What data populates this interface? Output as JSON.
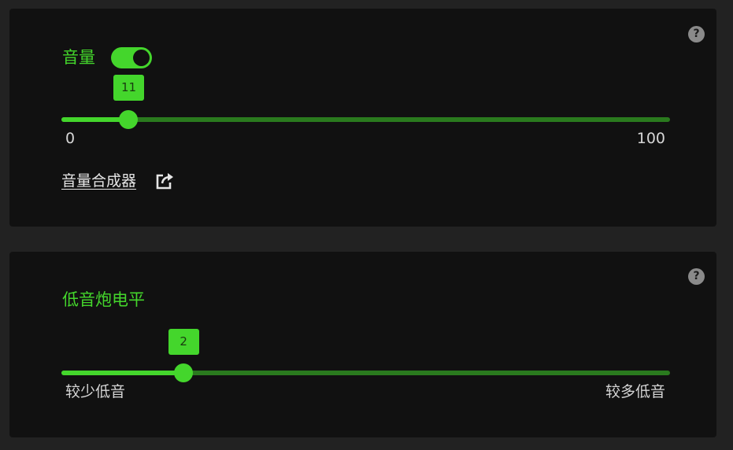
{
  "volume": {
    "title": "音量",
    "toggle_on": true,
    "value": 11,
    "min": 0,
    "max": 100,
    "min_label": "0",
    "max_label": "100",
    "mixer_link": "音量合成器"
  },
  "subwoofer": {
    "title": "低音炮电平",
    "value": 2,
    "min": 0,
    "max": 10,
    "min_label": "较少低音",
    "max_label": "较多低音"
  },
  "help_label": "?",
  "colors": {
    "accent": "#44d62c",
    "track": "#2a7a1e",
    "panel": "#111111",
    "background": "#222222"
  }
}
